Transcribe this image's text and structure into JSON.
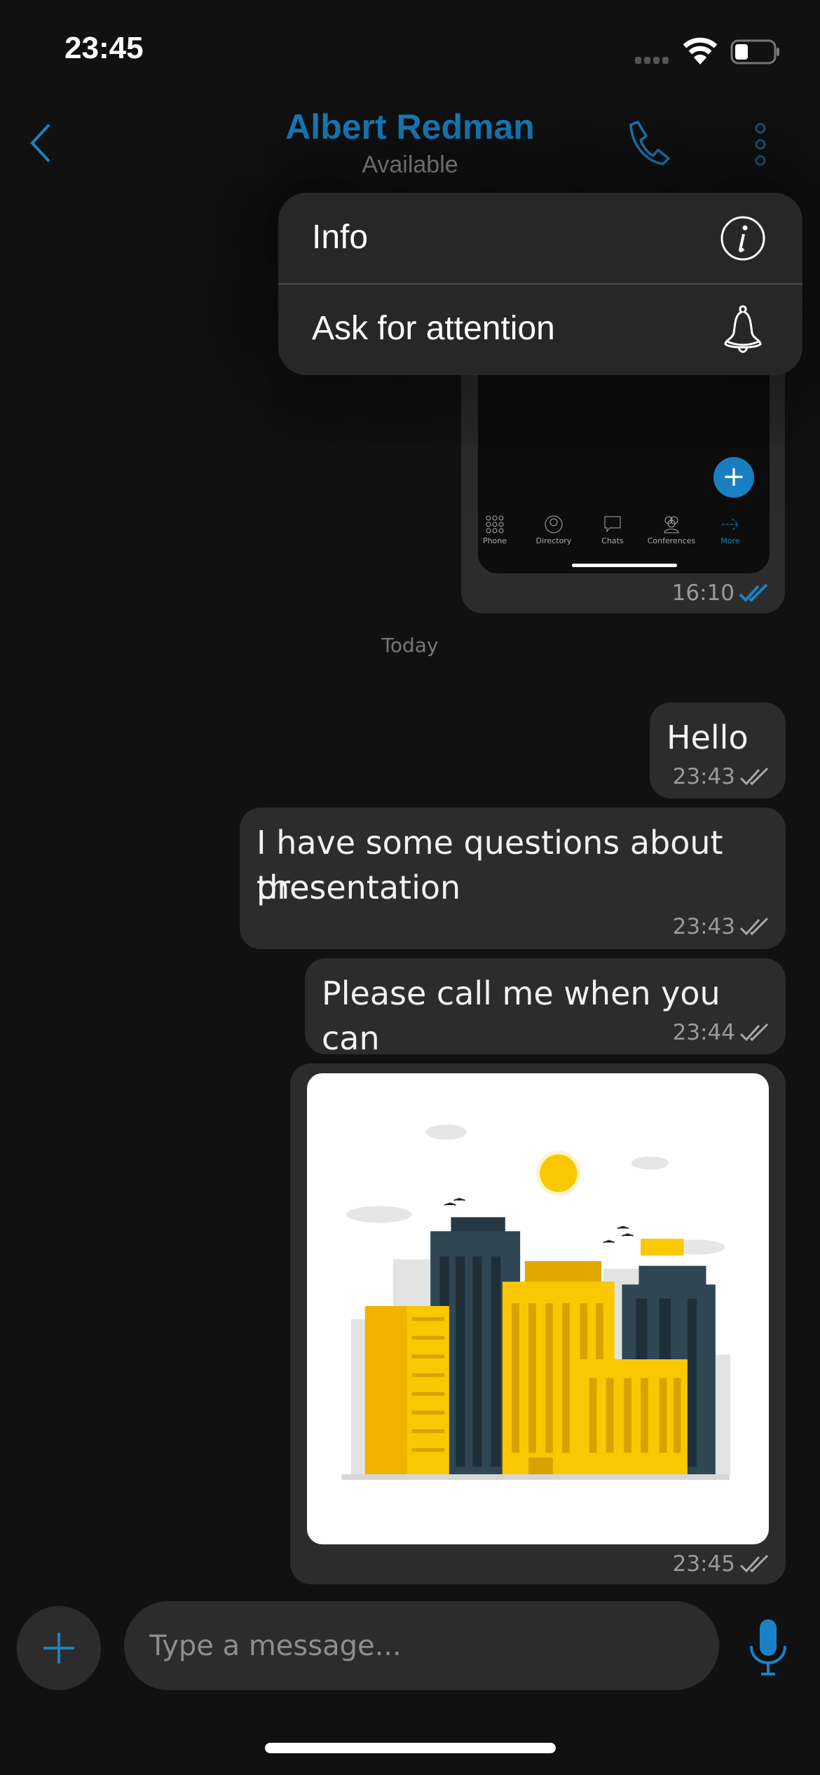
{
  "status_bar": {
    "time": "23:45",
    "battery_level": 0.3
  },
  "header": {
    "title": "Albert Redman",
    "status": "Available"
  },
  "menu": {
    "items": [
      {
        "label": "Info",
        "icon": "info-icon"
      },
      {
        "label": "Ask for attention",
        "icon": "bell-icon"
      }
    ]
  },
  "screenshot_message": {
    "tabs": [
      "Phone",
      "Directory",
      "Chats",
      "Conferences",
      "More"
    ],
    "time": "16:10"
  },
  "date_separator": "Today",
  "messages": [
    {
      "text": "Hello",
      "time": "23:43"
    },
    {
      "text_lines": [
        "I have some questions about the",
        "presentation"
      ],
      "time": "23:43"
    },
    {
      "text": "Please call me when you can",
      "time": "23:44"
    },
    {
      "image": "city-buildings-illustration",
      "time": "23:45"
    }
  ],
  "composer": {
    "placeholder": "Type a message..."
  },
  "colors": {
    "accent": "#1a82c4",
    "background": "#111111",
    "bubble": "#2c2c2c",
    "menu": "#272727"
  }
}
